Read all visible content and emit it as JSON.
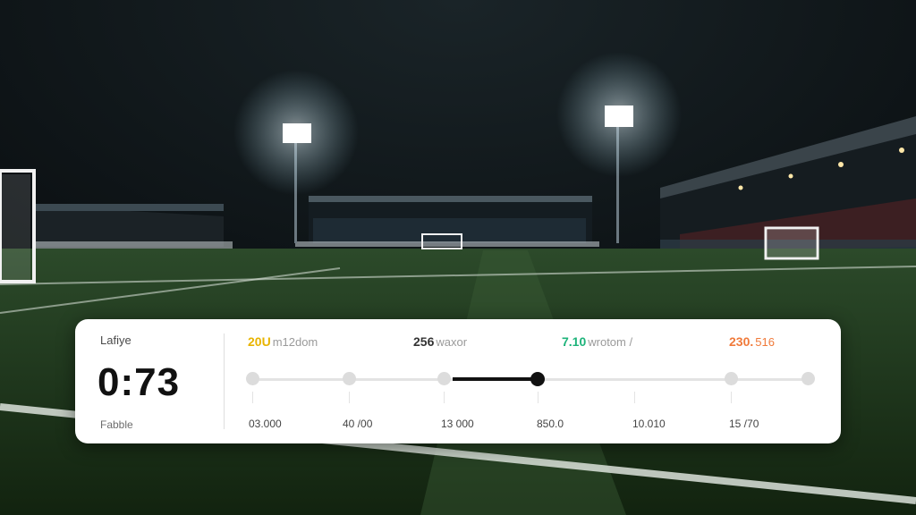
{
  "panel": {
    "label_top": "Lafiye",
    "score": "0:73",
    "label_bottom": "Fabble",
    "headers": [
      {
        "value": "20U",
        "label": "m12dom",
        "color": "#e8b400"
      },
      {
        "value": "256",
        "label": "waxor",
        "color": "#333333"
      },
      {
        "value": "7.10",
        "label": "wrotom /",
        "color": "#1db37a"
      },
      {
        "value": "230.",
        "label": "516",
        "color": "#f07a3a"
      }
    ],
    "timeline_labels": [
      "03.000",
      "40 /00",
      "13 000",
      "850.0",
      "10.010",
      "15 /70"
    ],
    "active_index": 3,
    "colors": {
      "active": "#111111",
      "inactive": "#dcdcdc"
    }
  }
}
